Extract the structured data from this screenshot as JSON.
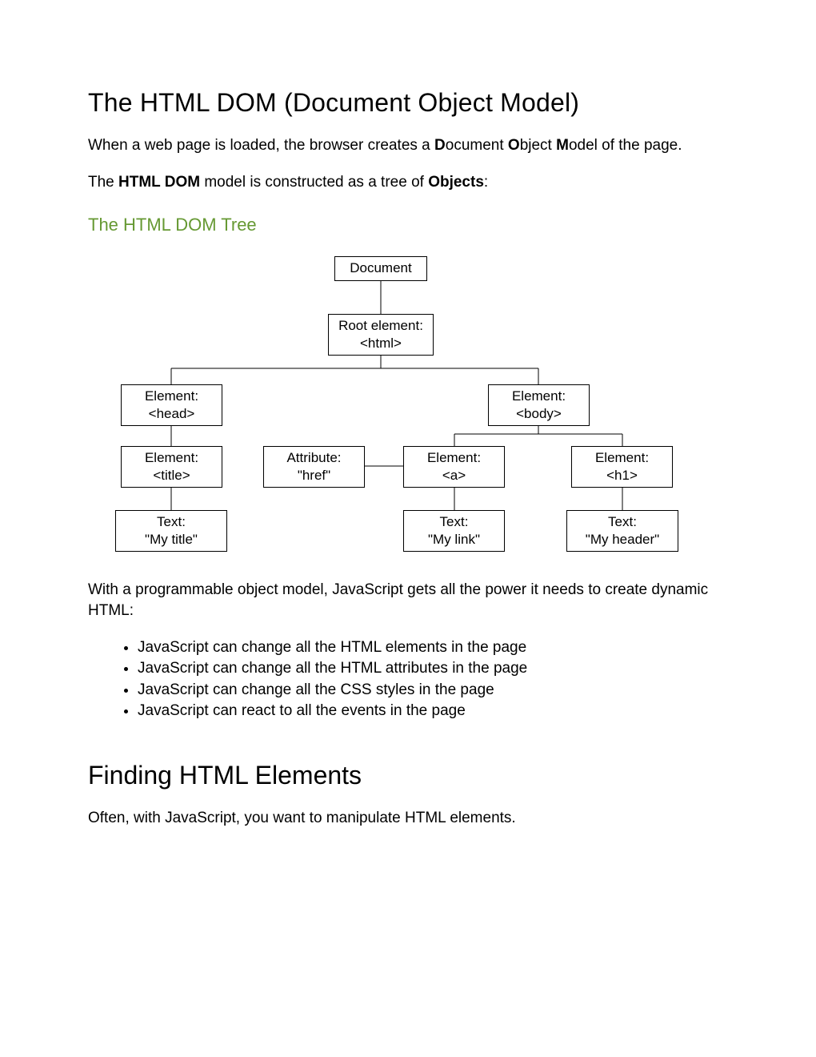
{
  "title_h1": "The HTML DOM (Document Object Model)",
  "intro": {
    "pre_d": "When a web page is loaded, the browser creates a ",
    "d": "D",
    "ocument": "ocument ",
    "o": "O",
    "bject": "bject ",
    "m": "M",
    "odel": "odel of the page."
  },
  "line2": {
    "pre": "The ",
    "bold1": "HTML DOM",
    "mid": " model is constructed as a tree of ",
    "bold2": "Objects",
    "post": ":"
  },
  "subhead": "The HTML DOM Tree",
  "diagram": {
    "document": "Document",
    "root_l1": "Root element:",
    "root_l2": "<html>",
    "head_l1": "Element:",
    "head_l2": "<head>",
    "body_l1": "Element:",
    "body_l2": "<body>",
    "title_l1": "Element:",
    "title_l2": "<title>",
    "attr_l1": "Attribute:",
    "attr_l2": "\"href\"",
    "a_l1": "Element:",
    "a_l2": "<a>",
    "h1_l1": "Element:",
    "h1_l2": "<h1>",
    "txt1_l1": "Text:",
    "txt1_l2": "\"My title\"",
    "txt2_l1": "Text:",
    "txt2_l2": "\"My link\"",
    "txt3_l1": "Text:",
    "txt3_l2": "\"My header\""
  },
  "after_diagram": "With a programmable object model, JavaScript gets all the power it needs to create dynamic HTML:",
  "bullets": [
    "JavaScript can change all the HTML elements in the page",
    "JavaScript can change all the HTML attributes in the page",
    "JavaScript can change all the CSS styles in the page",
    "JavaScript can react to all the events in the page"
  ],
  "h2_finding": "Finding HTML Elements",
  "finding_p": "Often, with JavaScript, you want to manipulate HTML elements."
}
